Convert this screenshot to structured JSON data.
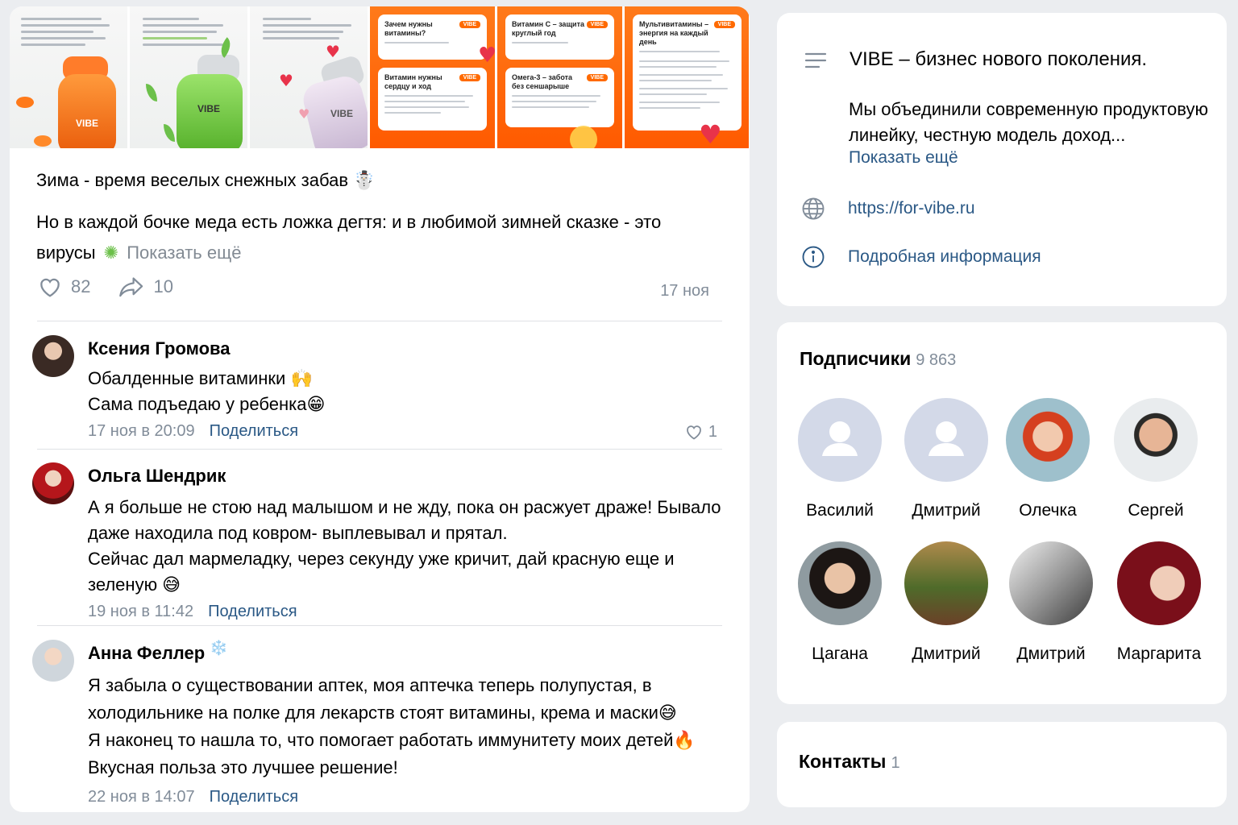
{
  "post": {
    "line1": "Зима - время веселых снежных забав ☃️",
    "line2a": "Но в каждой бочке меда есть ложка дегтя: и в любимой зимней сказке - это",
    "line2b": "вирусы",
    "show_more": "Показать ещё",
    "likes": "82",
    "shares": "10",
    "date": "17 ноя",
    "gallery": [
      {
        "brand": "VIBE"
      },
      {
        "brand": "VIBE"
      },
      {
        "brand": "VIBE"
      },
      {
        "brand": "VIBE",
        "card1": "Зачем нужны витамины?",
        "card2": "Витамин нужны сердцу и ход"
      },
      {
        "brand": "VIBE",
        "card1": "Витамин С – защита круглый год",
        "card2": "Омега-3 – забота без сеншарыше"
      },
      {
        "brand": "VIBE",
        "card1": "Мультивитамины – энергия на каждый день"
      }
    ]
  },
  "comments": [
    {
      "author": "Ксения Громова",
      "lines": [
        "Обалденные витаминки 🙌",
        "Сама подъедаю у ребенка😁"
      ],
      "time": "17 ноя в 20:09",
      "share": "Поделиться",
      "likes": "1"
    },
    {
      "author": "Ольга Шендрик",
      "lines": [
        "А я больше не стою над малышом и не жду, пока он расжует драже! Бывало",
        "даже находила под ковром- выплевывал и прятал.",
        "Сейчас дал мармеладку, через секунду уже кричит, дай красную еще и",
        "зеленую 😅"
      ],
      "time": "19 ноя в 11:42",
      "share": "Поделиться"
    },
    {
      "author": "Анна Феллер",
      "author_badge": "❄️",
      "lines": [
        "Я забыла о существовании аптек, моя аптечка теперь полупустая, в",
        "холодильнике на полке для лекарств стоят витамины, крема и маски😅",
        "Я наконец то нашла то, что помогает работать иммунитету моих детей🔥",
        "Вкусная польза это лучшее решение!"
      ],
      "time": "22 ноя в 14:07",
      "share": "Поделиться"
    }
  ],
  "about": {
    "title": "VIBE – бизнес нового поколения.",
    "desc": "Мы объединили современную продуктовую линейку, честную модель доход...",
    "show_more": "Показать ещё",
    "website": "https://for-vibe.ru",
    "details": "Подробная информация"
  },
  "subscribers": {
    "title": "Подписчики",
    "count": "9 863",
    "people": [
      "Василий",
      "Дмитрий",
      "Олечка",
      "Сергей",
      "Цагана",
      "Дмитрий",
      "Дмитрий",
      "Маргарита"
    ]
  },
  "contacts": {
    "title": "Контакты",
    "count": "1"
  },
  "colors": {
    "link": "#2a5885",
    "muted": "#818c99",
    "brand_orange": "#ff6a00"
  }
}
